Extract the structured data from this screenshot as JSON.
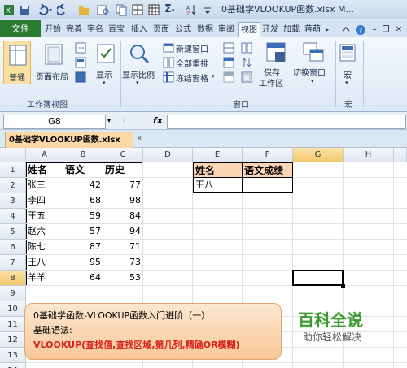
{
  "window": {
    "title": "0基础学VLOOKUP函数.xlsx M..."
  },
  "ribbon": {
    "file_tab": "文件",
    "tabs": [
      "开始",
      "完善",
      "字名",
      "百宝",
      "插入",
      "页面",
      "公式",
      "数据",
      "审阅",
      "视图",
      "开发",
      "加载",
      "蒋萌"
    ],
    "active_tab": "视图",
    "groups": {
      "workbook_views": {
        "label": "工作簿视图",
        "normal": "普通",
        "page_layout": "页面布局"
      },
      "show": {
        "label": "显示"
      },
      "zoom": {
        "label": "显示比例"
      },
      "window": {
        "label": "窗口",
        "new_window": "新建窗口",
        "arrange_all": "全部重排",
        "freeze_panes": "冻结窗格",
        "save_workspace": "保存\n工作区",
        "switch_windows": "切换窗口"
      },
      "macros": {
        "label": "宏",
        "macro": "宏"
      }
    }
  },
  "formula_bar": {
    "name_box": "G8",
    "fx": "fx",
    "formula": ""
  },
  "workbook_tab": "0基础学VLOOKUP函数.xlsx",
  "sheet": {
    "columns": [
      "A",
      "B",
      "C",
      "D",
      "E",
      "F",
      "G",
      "H"
    ],
    "rows": [
      "1",
      "2",
      "3",
      "4",
      "5",
      "6",
      "7",
      "8",
      "9",
      "10",
      "11",
      "12",
      "13",
      "14"
    ],
    "table1": {
      "headers": [
        "姓名",
        "语文",
        "历史"
      ],
      "rows": [
        [
          "张三",
          "42",
          "77"
        ],
        [
          "李四",
          "68",
          "98"
        ],
        [
          "王五",
          "59",
          "84"
        ],
        [
          "赵六",
          "57",
          "94"
        ],
        [
          "陈七",
          "87",
          "71"
        ],
        [
          "王八",
          "95",
          "73"
        ],
        [
          "羊羊",
          "64",
          "53"
        ]
      ]
    },
    "table2": {
      "headers": [
        "姓名",
        "语文成绩"
      ],
      "rows": [
        [
          "王八",
          ""
        ]
      ]
    }
  },
  "note": {
    "line1": "0基础学函数-VLOOKUP函数入门进阶（一）",
    "line2": "基础语法:",
    "line3": "VLOOKUP(查找值,查找区域,第几列,精确OR模糊)"
  },
  "watermark": {
    "title": "百科全说",
    "subtitle": "助你轻松解决"
  },
  "colors": {
    "file_tab": "#2a7a2f",
    "header_fill_table2": "#fcd5b4",
    "note_text_red": "#d8211a",
    "logo_green": "#3a9a2e"
  }
}
